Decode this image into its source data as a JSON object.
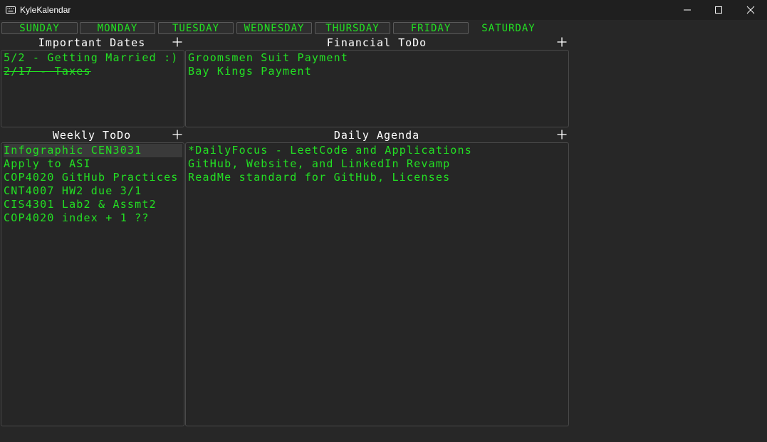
{
  "window": {
    "title": "KyleKalendar"
  },
  "days": [
    "SUNDAY",
    "MONDAY",
    "TUESDAY",
    "WEDNESDAY",
    "THURSDAY",
    "FRIDAY",
    "SATURDAY"
  ],
  "active_day": "SATURDAY",
  "sections": {
    "important_dates": {
      "title": "Important Dates",
      "add_label": "+",
      "items": [
        {
          "text": "5/2 - Getting Married :)",
          "done": false
        },
        {
          "text": "2/17 - Taxes",
          "done": true
        }
      ]
    },
    "financial_todo": {
      "title": "Financial ToDo",
      "add_label": "+",
      "items": [
        {
          "text": "Groomsmen Suit Payment",
          "done": false
        },
        {
          "text": "Bay Kings Payment",
          "done": false
        }
      ]
    },
    "weekly_todo": {
      "title": "Weekly ToDo",
      "add_label": "+",
      "items": [
        {
          "text": "Infographic CEN3031",
          "done": false,
          "selected": true
        },
        {
          "text": "Apply to ASI",
          "done": false
        },
        {
          "text": "COP4020 GitHub Practices",
          "done": false
        },
        {
          "text": "CNT4007 HW2 due 3/1",
          "done": false
        },
        {
          "text": "CIS4301 Lab2 & Assmt2",
          "done": false
        },
        {
          "text": "COP4020 index + 1 ??",
          "done": false
        }
      ]
    },
    "daily_agenda": {
      "title": "Daily Agenda",
      "add_label": "+",
      "items": [
        {
          "text": "*DailyFocus - LeetCode and Applications",
          "done": false
        },
        {
          "text": "GitHub, Website, and LinkedIn Revamp",
          "done": false
        },
        {
          "text": "ReadMe standard for GitHub, Licenses",
          "done": false
        }
      ]
    }
  },
  "icons": {
    "app": "keyboard-icon",
    "minimize": "minimize-icon",
    "maximize": "maximize-icon",
    "close": "close-icon",
    "add": "plus-icon"
  },
  "colors": {
    "background": "#272727",
    "text_green": "#23e023",
    "title_white": "#ffffff",
    "titlebar": "#1f1f1f"
  }
}
